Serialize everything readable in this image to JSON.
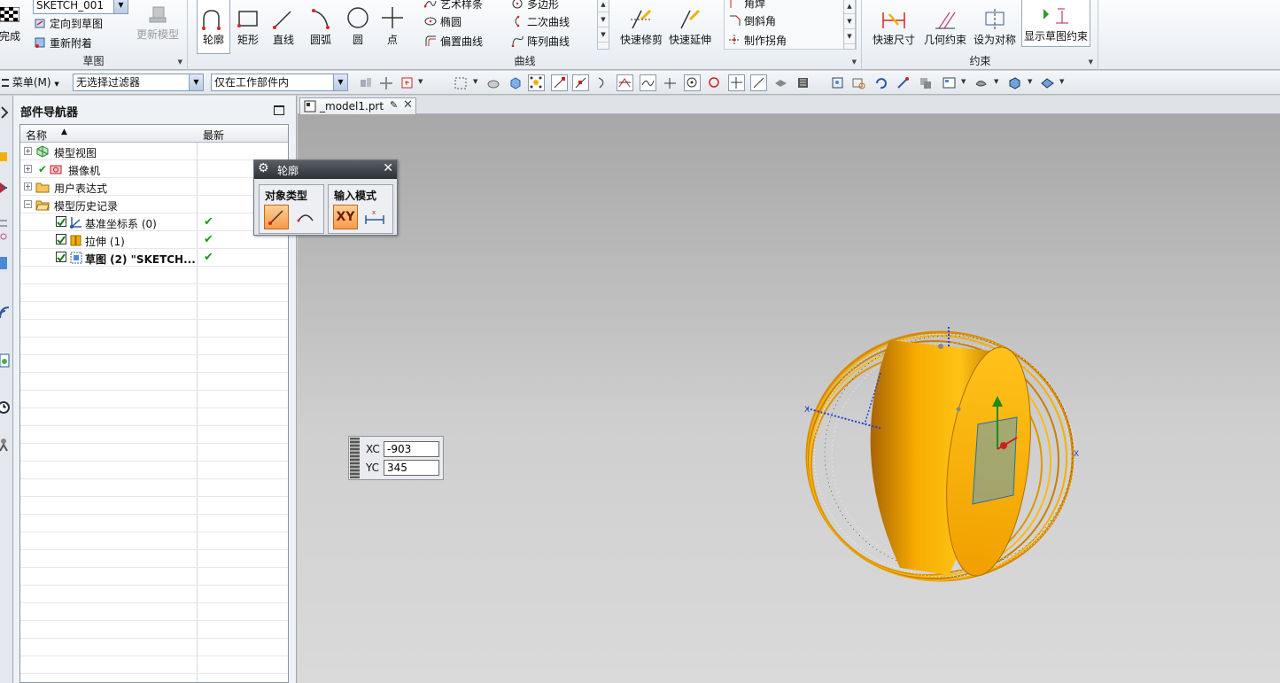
{
  "ribbon": {
    "sketch_group": {
      "finish_label": "完成",
      "sketch_name_value": "SKETCH_001",
      "orient_label": "定向到草图",
      "reattach_label": "重新附着",
      "update_model_label": "更新模型",
      "group_label": "草图"
    },
    "curve_group": {
      "profile_label": "轮廓",
      "rectangle_label": "矩形",
      "line_label": "直线",
      "arc_label": "圆弧",
      "circle_label": "圆",
      "point_label": "点",
      "studio_spline_label": "艺术样条",
      "polygon_label": "多边形",
      "ellipse_label": "椭圆",
      "conic_label": "二次曲线",
      "offset_curve_label": "偏置曲线",
      "pattern_curve_label": "阵列曲线",
      "quick_trim_label": "快速修剪",
      "quick_extend_label": "快速延伸",
      "fillet_label": "角焊",
      "chamfer_label": "倒斜角",
      "make_corner_label": "制作拐角",
      "group_label": "曲线"
    },
    "constraint_group": {
      "rapid_dimension_label": "快速尺寸",
      "geometric_constraints_label": "几何约束",
      "make_symmetric_label": "设为对称",
      "display_constraints_label": "显示草图约束",
      "group_label": "约束"
    }
  },
  "toolbar": {
    "menu_label": "菜单(M)",
    "selection_filter_value": "无选择过滤器",
    "scope_value": "仅在工作部件内"
  },
  "navigator": {
    "title": "部件导航器",
    "col_name": "名称",
    "col_latest": "最新",
    "rows": [
      {
        "label": "模型视图",
        "expander": "+"
      },
      {
        "label": "摄像机",
        "expander": "+"
      },
      {
        "label": "用户表达式",
        "expander": "+"
      },
      {
        "label": "模型历史记录",
        "expander": "−"
      },
      {
        "label": "基准坐标系 (0)",
        "latest": "✔"
      },
      {
        "label": "拉伸 (1)",
        "latest": "✔"
      },
      {
        "label": "草图 (2) \"SKETCH...",
        "latest": "✔"
      }
    ]
  },
  "tab": {
    "label": "_model1.prt"
  },
  "profile_dialog": {
    "title": "轮廓",
    "object_type_label": "对象类型",
    "input_mode_label": "输入模式",
    "xy_label": "XY"
  },
  "coords": {
    "xc_label": "XC",
    "xc_value": "-903",
    "yc_label": "YC",
    "yc_value": "345"
  },
  "colors": {
    "model_orange": "#f2a300",
    "model_dark": "#c07a00",
    "dialog_title": "#2d3136",
    "active_button": "#f59b4a"
  }
}
